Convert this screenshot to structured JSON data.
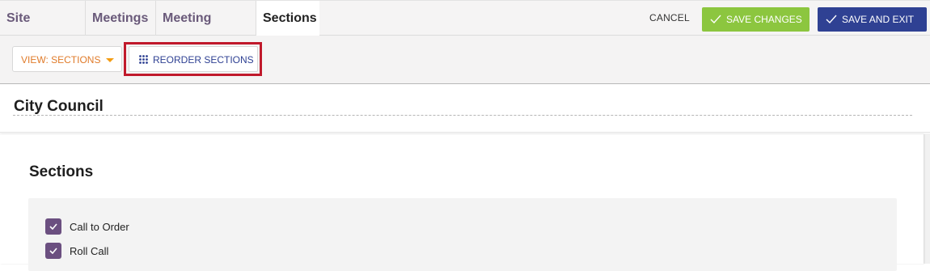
{
  "nav": {
    "tabs": [
      {
        "label": "Site Settings"
      },
      {
        "label": "Meetings"
      },
      {
        "label": "Meeting Types"
      },
      {
        "label": "Sections"
      }
    ],
    "cancel_label": "CANCEL",
    "save_changes_label": "SAVE CHANGES",
    "save_exit_label": "SAVE AND EXIT"
  },
  "toolbar": {
    "view_select": "VIEW: SECTIONS",
    "reorder_label": "REORDER SECTIONS"
  },
  "page": {
    "title": "City Council"
  },
  "sections": {
    "heading": "Sections",
    "items": [
      {
        "label": "Call to Order",
        "checked": true
      },
      {
        "label": "Roll Call",
        "checked": true
      }
    ]
  },
  "colors": {
    "save_changes": "#8cc63f",
    "save_exit": "#2f4193",
    "highlight": "#c0192b",
    "checkbox": "#6b4f80",
    "view_select_text": "#e07b2a"
  }
}
